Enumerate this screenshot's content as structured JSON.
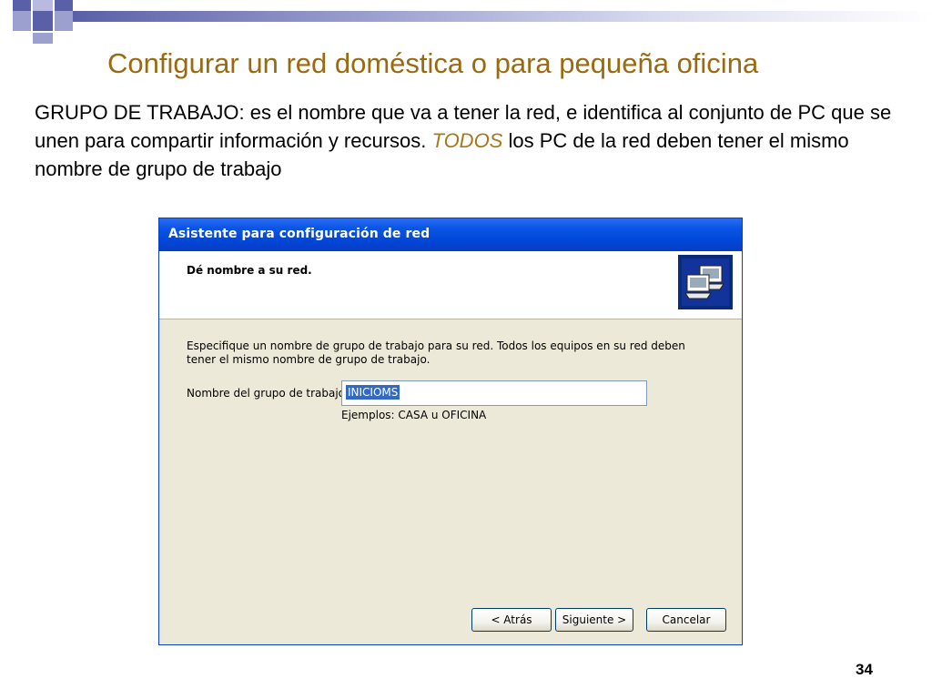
{
  "slide": {
    "title": "Configurar un red doméstica o para pequeña oficina",
    "body_part1": "GRUPO DE TRABAJO: es el nombre que va a tener la red, e identifica al conjunto de PC que se unen para compartir información y recursos. ",
    "body_emphasis": "TODOS",
    "body_part2": " los PC de la red deben tener el mismo nombre de grupo de trabajo",
    "page_number": "34",
    "emphasis_color": "#a8781e",
    "title_color": "#9a6a10"
  },
  "dialog": {
    "title": "Asistente para configuración de red",
    "header_title": "Dé nombre a su red.",
    "header_icon": "network-computers-icon",
    "description": "Especifique un nombre de grupo de trabajo para su red. Todos los equipos en su red deben tener el mismo nombre de grupo de trabajo.",
    "field_label": "Nombre del grupo de trabajo:",
    "field_value": "INICIOMS",
    "field_hint": "Ejemplos: CASA u OFICINA",
    "buttons": {
      "back": "< Atrás",
      "next": "Siguiente >",
      "cancel": "Cancelar"
    },
    "titlebar_color": "#0a55e4"
  }
}
